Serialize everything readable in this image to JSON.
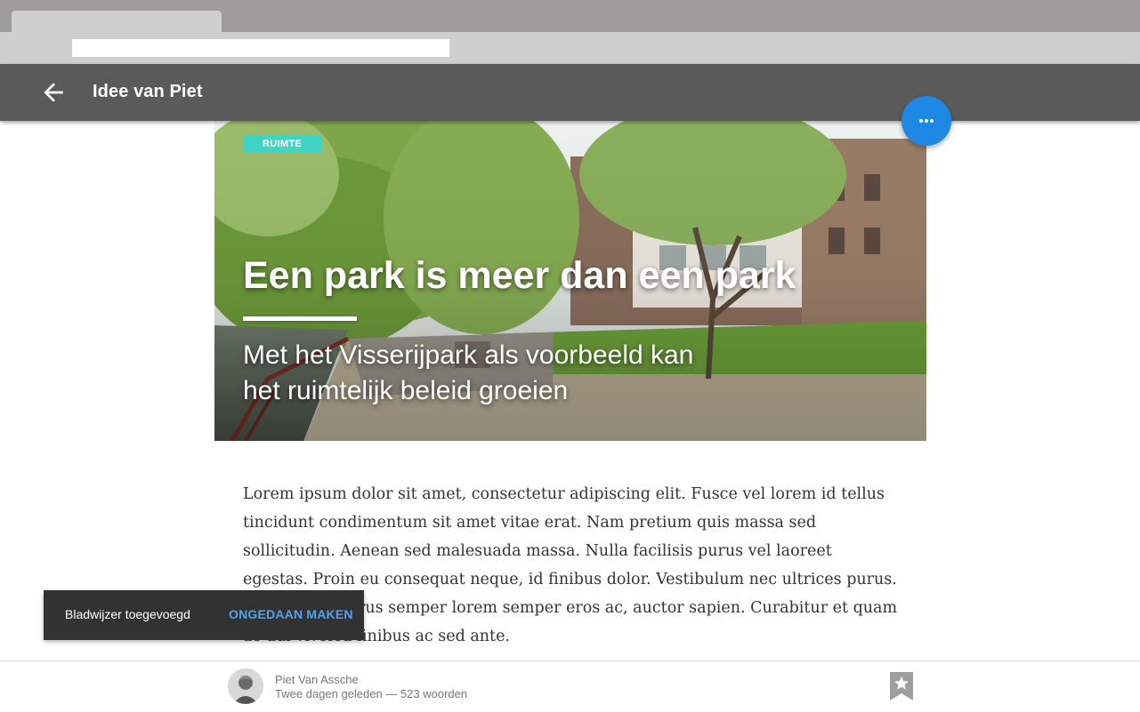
{
  "browser": {
    "tab_title": "",
    "url": ""
  },
  "appbar": {
    "title": "Idee van Piet",
    "back_icon": "arrow-back-icon"
  },
  "fab": {
    "icon": "more-horizontal-icon",
    "color": "#1e88e5"
  },
  "hero": {
    "category": "RUIMTE",
    "category_color": "#3fd4c6",
    "title": "Een park is meer dan een park",
    "subtitle_lines": [
      "Met het Visserijpark als voorbeeld kan",
      "het ruimtelijk beleid groeien"
    ]
  },
  "article": {
    "body": "Lorem ipsum dolor sit amet, consectetur adipiscing elit. Fusce vel lorem id tellus tincidunt condimentum sit amet vitae erat. Nam pretium quis massa sed sollicitudin. Aenean sed malesuada massa. Nulla facilisis purus vel laoreet egestas. Proin eu consequat neque, id finibus dolor. Vestibulum nec ultrices purus. Praesent id purus semper lorem semper eros ac, auctor sapien. Curabitur et quam ac dui viverra finibus ac sed ante."
  },
  "snackbar": {
    "message": "Bladwijzer toegevoegd",
    "action": "ONGEDAAN MAKEN",
    "action_color": "#4fa3f0"
  },
  "footer": {
    "author": "Piet Van Assche",
    "meta": "Twee dagen geleden — 523 woorden",
    "bookmark_icon": "bookmark-star-icon"
  }
}
